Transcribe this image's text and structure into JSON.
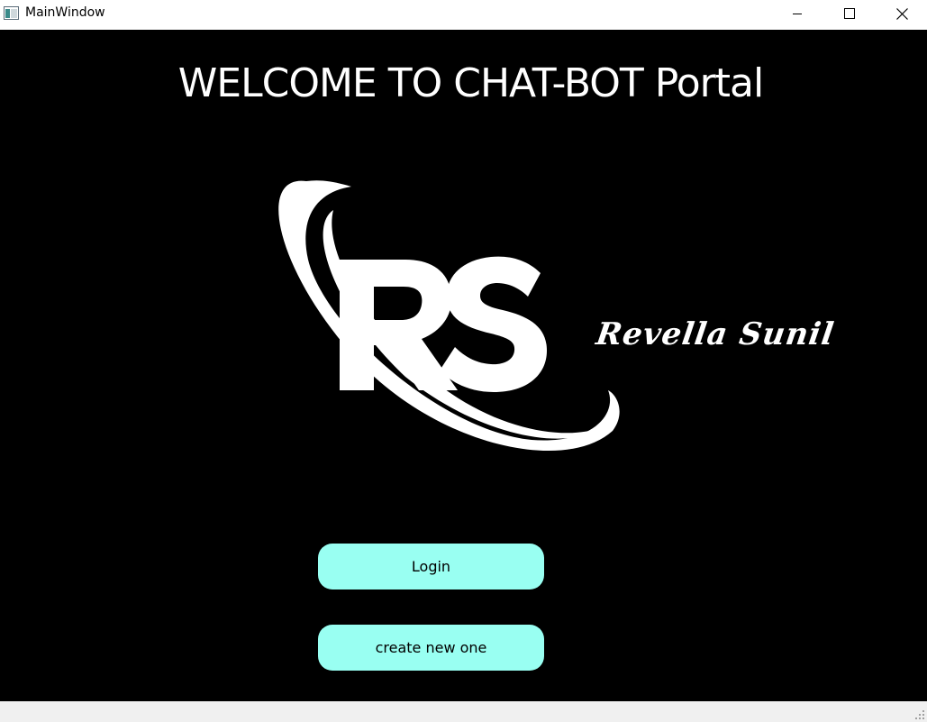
{
  "window": {
    "title": "MainWindow",
    "icon": "app-window-icon",
    "controls": [
      "minimize-icon",
      "maximize-icon",
      "close-icon"
    ]
  },
  "main": {
    "heading": "WELCOME TO CHAT-BOT Portal",
    "logo": {
      "monogram": "RS",
      "signature": "Revella Sunil"
    },
    "buttons": {
      "login_label": "Login",
      "create_label": "create new one"
    }
  },
  "colors": {
    "background": "#000000",
    "button": "#99fff2",
    "text_light": "#ffffff",
    "statusbar": "#f0f0f0"
  }
}
